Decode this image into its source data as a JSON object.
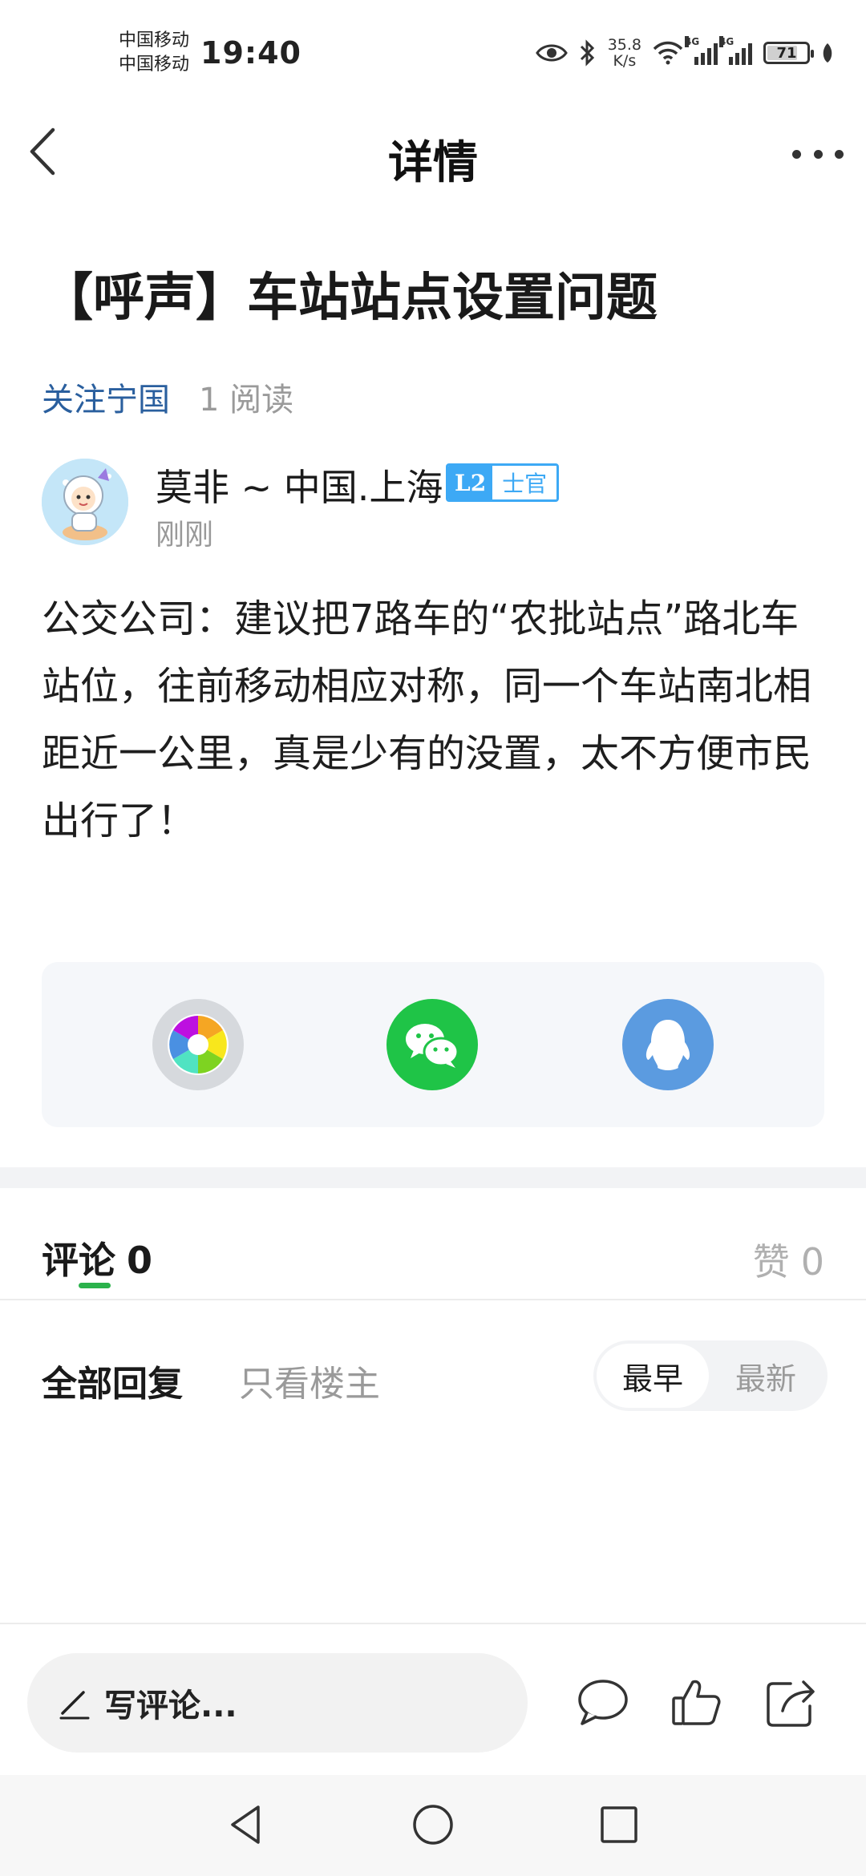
{
  "status_bar": {
    "carrier_1": "中国移动",
    "carrier_2": "中国移动",
    "time": "19:40",
    "net_speed_value": "35.8",
    "net_speed_unit": "K/s",
    "network_1": "4G",
    "network_2": "4G",
    "battery_level": "71"
  },
  "nav": {
    "title": "详情"
  },
  "post": {
    "title": "【呼声】车站站点设置问题",
    "topic": "关注宁国",
    "read_count": "1 阅读",
    "author": {
      "name": "莫非 ~ 中国.上海",
      "level": "L2",
      "rank": "士官",
      "time": "刚刚"
    },
    "body": "公交公司：建议把7路车的“农批站点”路北车站位，往前移动相应对称，同一个车站南北相距近一公里，真是少有的没置，太不方便市民出行了！"
  },
  "share": {
    "items": [
      "moments-icon",
      "wechat-icon",
      "qq-icon"
    ]
  },
  "comments": {
    "tab_label": "评论",
    "count": "0",
    "likes_label": "赞",
    "likes_count": "0",
    "filter_all": "全部回复",
    "filter_op": "只看楼主",
    "sort_earliest": "最早",
    "sort_latest": "最新"
  },
  "bottom_bar": {
    "write_comment": "写评论..."
  },
  "colors": {
    "accent_green": "#2bb24c",
    "topic_blue": "#2a5f9e",
    "badge_blue": "#3da9f5",
    "wechat_green": "#1fc447",
    "qq_blue": "#5b9be0"
  }
}
